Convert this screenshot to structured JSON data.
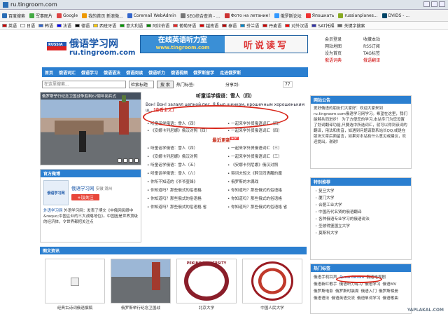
{
  "browser": {
    "url": "ru.tingroom.com",
    "bookmarks": [
      "百度搜索",
      "军事图片",
      "Google",
      "我的首页 新浪微...",
      "Coremail WebAdmin",
      "SEO综合查询 - ...",
      "Фото на летание!",
      "俄罗斯论坛",
      "Япошкать",
      "russianplanes...",
      "DVIDS - ..."
    ],
    "bookmarks2": [
      "英语",
      "日语",
      "韩语",
      "法语",
      "德语",
      "西班牙语",
      "意大利语",
      "阿拉伯语",
      "葡萄牙语",
      "越南语",
      "泰语",
      "芬兰语",
      "丹麦语",
      "对外汉语",
      "SAT托福",
      "关键字搜索"
    ]
  },
  "header": {
    "logo_cn": "俄语学习网",
    "logo_flag_text": "RUSSIA",
    "logo_url": "ru.tingroom.com",
    "banner_main": "在线英语听力室",
    "banner_sub": "www.tingroom.com",
    "banner_right": "听说读写",
    "toplinks": [
      "会员登录",
      "收藏本站",
      "网站地图",
      "RSS订阅",
      "设为首页",
      "TAG标签",
      "俄语词典",
      "俄语翻译"
    ]
  },
  "nav": [
    "首页",
    "俄语词汇",
    "俄语学习",
    "俄语语法",
    "俄语阅读",
    "俄语听力",
    "俄语视频",
    "俄罗斯留学",
    "走进俄罗斯"
  ],
  "search": {
    "placeholder": "在这里搜索...",
    "select": "检索标题",
    "button": "搜 索",
    "hot_label": "热门标签:",
    "share_label": "分享到:",
    "count": "77"
  },
  "photo": {
    "caption": "俄罗斯举行纪念卫国战争胜利67周年阅兵式"
  },
  "center": {
    "title": "听童话学俄语：雪人（四）",
    "quote": "Вон! Вон! залаял цепной пес. Я был щенком, крошечным хорошеньким щ...",
    "more": "[查看全文]",
    "links_top": [
      "听童话学俄语：雪人（四）",
      "一起来学外贸俄语词汇（四）",
      "《安娜卡列尼娜》俄汉对照（四）",
      "一起来学外贸俄语词汇（四）"
    ],
    "latest_label": "最近更新",
    "hot_badge": "HOT",
    "links_bottom": [
      "听童话学俄语：雪人（四）",
      "一起来学外贸俄语词汇（三）",
      "《安娜卡列尼娜》俄汉对照",
      "一起来学外贸俄语词汇（三）",
      "听童话学俄语：雪人（五）",
      "《安娜卡列尼娜》俄汉对照",
      "听童话学俄语：雪人（六）",
      "契诃夫短文《醉汉同清醒的魔",
      "你所不知道的《爷爷壹锋》",
      "俄罗斯的木偶戏",
      "你知道吗？那些俄式的俗语格",
      "你知道吗？那些俄式的俗语格",
      "你知道吗？那些俄式的俗语格",
      "你知道吗？那些俄式的俗语格",
      "你知道吗？那些俄式的俗语格 省",
      "你知道吗？那些俄式的俗语格 省"
    ]
  },
  "official": {
    "title": "官方微博",
    "avatar_text": "俄语学习网",
    "name": "俄语学习网",
    "location": "安徽 滁州",
    "follow": "+加关注",
    "weibo": "外语学习网：发表了博文《中俄网民眼中&raquo;中国企业的三大战略地位》。中国因是世界顶级的经济体，令世界都把关注点",
    "weibo_name": "外语学习网"
  },
  "sideinfo": {
    "title": "网站公告",
    "text": "爱好俄语的朋友们大家好：欢迎大家来到ru.tingroom.com俄语学习网学习。希望在这里，我们能够共同进步！ 为了方便您的学习,本站专门为您设置了划词翻译功能,只要选中所选词汇，就可以得到该词的翻译，用法和发音，如遇到问题请联系站长QQ,或是在版块文章后面留言，如果对本站有什么意见或建议，欢迎提出，谢谢！"
  },
  "special": {
    "title": "特别推荐",
    "items": [
      "复旦大学",
      "厦门大学",
      "合肥工业大学",
      "中国历代名贤的俄语翻译",
      "各种俄语专业学习的俄语说法",
      "圣彼得堡国立大学",
      "莫斯科大学"
    ]
  },
  "hottags": {
    "title": "热门标签",
    "tags": [
      "俄语手机铃声",
      "Дима Билан",
      "俄语电视剧",
      "俄语新红歌手",
      "俄语听力练习",
      "俄语学习",
      "俄语MV",
      "俄罗斯电影",
      "俄罗斯时装周",
      "俄语入门",
      "俄罗斯相册",
      "俄语语法",
      "俄语英语交流",
      "俄语单词学习",
      "俄语歌曲"
    ]
  },
  "imgnews": {
    "title": "图文资讯",
    "cards": [
      "经典古诗词俄语撰稿",
      "俄罗斯举行纪念卫国战",
      "北京大学",
      "中国人民大学"
    ],
    "seal1": "PEKING UNIVERSITY"
  },
  "watermark": "YAPLAKAL.COM",
  "colors": {
    "nav": "#2b7fd0",
    "accent": "#d8261a",
    "link": "#1a57a8"
  }
}
